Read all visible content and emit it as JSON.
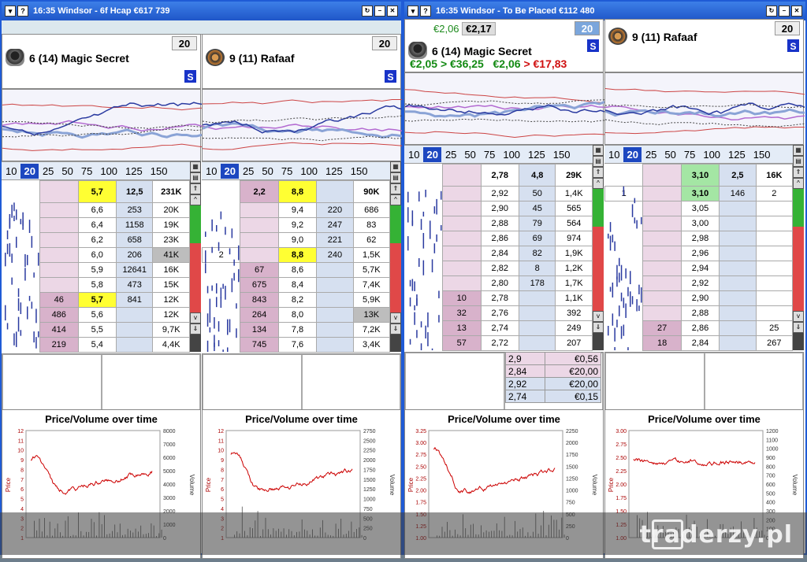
{
  "windows": [
    {
      "time": "16:35",
      "title_text": "16:35  Windsor - 6f Hcap   €617 739",
      "panels": [
        {
          "runner": "6  (14) Magic Secret",
          "stake": "20",
          "s": "S",
          "tabs": [
            "10",
            "20",
            "25",
            "50",
            "75",
            "100",
            "125",
            "150"
          ],
          "header": [
            "",
            "",
            "5,7",
            "12,5",
            "231K"
          ],
          "rows": [
            [
              "",
              "",
              "6,6",
              "253",
              "20K"
            ],
            [
              "",
              "",
              "6,4",
              "1158",
              "19K"
            ],
            [
              "",
              "",
              "6,2",
              "658",
              "23K"
            ],
            [
              "",
              "",
              "6,0",
              "206",
              "41K"
            ],
            [
              "",
              "",
              "5,9",
              "12641",
              "16K"
            ],
            [
              "",
              "",
              "5,8",
              "473",
              "15K"
            ],
            [
              "",
              "46",
              "5,7",
              "841",
              "12K"
            ],
            [
              "",
              "486",
              "5,6",
              "",
              "12K"
            ],
            [
              "",
              "414",
              "5,5",
              "",
              "9,7K"
            ],
            [
              "",
              "219",
              "5,4",
              "",
              "4,4K"
            ]
          ],
          "pv_title": "Price/Volume over time",
          "y_left": [
            "12",
            "11",
            "10",
            "9",
            "8",
            "7",
            "6",
            "5",
            "4",
            "3",
            "2",
            "1"
          ],
          "y_right": [
            "8000",
            "7000",
            "6000",
            "5000",
            "4000",
            "3000",
            "2000",
            "1000",
            "0"
          ],
          "ylabel_left": "Price",
          "ylabel_right": "Volume"
        },
        {
          "runner": "9  (11) Rafaaf",
          "stake": "20",
          "s": "S",
          "tabs": [
            "10",
            "20",
            "25",
            "50",
            "75",
            "100",
            "125",
            "150"
          ],
          "header": [
            "",
            "2,2",
            "8,8",
            "",
            "90K"
          ],
          "rows": [
            [
              "",
              "",
              "9,4",
              "220",
              "686"
            ],
            [
              "",
              "",
              "9,2",
              "247",
              "83"
            ],
            [
              "",
              "",
              "9,0",
              "221",
              "62"
            ],
            [
              "2",
              "",
              "8,8",
              "240",
              "1,5K"
            ],
            [
              "",
              "67",
              "8,6",
              "",
              "5,7K"
            ],
            [
              "",
              "675",
              "8,4",
              "",
              "7,4K"
            ],
            [
              "",
              "843",
              "8,2",
              "",
              "5,9K"
            ],
            [
              "",
              "264",
              "8,0",
              "",
              "13K"
            ],
            [
              "",
              "134",
              "7,8",
              "",
              "7,2K"
            ],
            [
              "",
              "745",
              "7,6",
              "",
              "3,4K"
            ]
          ],
          "pv_title": "Price/Volume over time",
          "y_left": [
            "12",
            "11",
            "10",
            "9",
            "8",
            "7",
            "6",
            "5",
            "4",
            "3",
            "2",
            "1"
          ],
          "y_right": [
            "2750",
            "2500",
            "2250",
            "2000",
            "1750",
            "1500",
            "1250",
            "1000",
            "750",
            "500",
            "250",
            "0"
          ],
          "ylabel_left": "Price",
          "ylabel_right": "Volume"
        }
      ]
    },
    {
      "title_text": "16:35  Windsor - To Be Placed   €112 480",
      "panels": [
        {
          "odds_small": "€2,06",
          "odds_box": "€2,17",
          "runner": "6  (14) Magic Secret",
          "stake": "20",
          "s": "S",
          "pl_line": {
            "a": "€2,05",
            "b": "> €36,25",
            "c": "€2,06",
            "d": "> €17,83"
          },
          "tabs": [
            "10",
            "20",
            "25",
            "50",
            "75",
            "100",
            "125",
            "150"
          ],
          "header": [
            "",
            "",
            "2,78",
            "4,8",
            "29K"
          ],
          "rows": [
            [
              "",
              "",
              "2,92",
              "50",
              "1,4K"
            ],
            [
              "",
              "",
              "2,90",
              "45",
              "565"
            ],
            [
              "",
              "",
              "2,88",
              "79",
              "564"
            ],
            [
              "",
              "",
              "2,86",
              "69",
              "974"
            ],
            [
              "",
              "",
              "2,84",
              "82",
              "1,9K"
            ],
            [
              "",
              "",
              "2,82",
              "8",
              "1,2K"
            ],
            [
              "",
              "",
              "2,80",
              "178",
              "1,7K"
            ],
            [
              "",
              "10",
              "2,78",
              "",
              "1,1K"
            ],
            [
              "",
              "32",
              "2,76",
              "",
              "392"
            ],
            [
              "",
              "13",
              "2,74",
              "",
              "249"
            ],
            [
              "",
              "57",
              "2,72",
              "",
              "207"
            ]
          ],
          "bets": [
            {
              "p": "2,9",
              "v": "€0,56",
              "type": "l"
            },
            {
              "p": "2,84",
              "v": "€20,00",
              "type": "l"
            },
            {
              "p": "2,92",
              "v": "€20,00",
              "type": "b"
            },
            {
              "p": "2,74",
              "v": "€0,15",
              "type": "b"
            }
          ],
          "pv_title": "Price/Volume over time",
          "y_left": [
            "3.25",
            "3.00",
            "2.75",
            "2.50",
            "2.25",
            "2.00",
            "1.75",
            "1.50",
            "1.25",
            "1.00"
          ],
          "y_right": [
            "2250",
            "2000",
            "1750",
            "1500",
            "1250",
            "1000",
            "750",
            "500",
            "250",
            "0"
          ],
          "ylabel_left": "Price",
          "ylabel_right": "Volume"
        },
        {
          "runner": "9  (11) Rafaaf",
          "stake": "20",
          "s": "S",
          "tabs": [
            "10",
            "20",
            "25",
            "50",
            "75",
            "100",
            "125",
            "150"
          ],
          "header": [
            "",
            "",
            "3,10",
            "2,5",
            "16K"
          ],
          "rows": [
            [
              "1",
              "",
              "3,10",
              "146",
              "2"
            ],
            [
              "",
              "",
              "3,05",
              "",
              ""
            ],
            [
              "",
              "",
              "3,00",
              "",
              ""
            ],
            [
              "",
              "",
              "2,98",
              "",
              ""
            ],
            [
              "",
              "",
              "2,96",
              "",
              ""
            ],
            [
              "",
              "",
              "2,94",
              "",
              ""
            ],
            [
              "",
              "",
              "2,92",
              "",
              ""
            ],
            [
              "",
              "",
              "2,90",
              "",
              ""
            ],
            [
              "",
              "",
              "2,88",
              "",
              ""
            ],
            [
              "",
              "27",
              "2,86",
              "",
              "25"
            ],
            [
              "",
              "18",
              "2,84",
              "",
              "267"
            ]
          ],
          "pv_title": "Price/Volume over time",
          "y_left": [
            "3.00",
            "2.75",
            "2.50",
            "2.25",
            "2.00",
            "1.75",
            "1.50",
            "1.25",
            "1.00"
          ],
          "y_right": [
            "1200",
            "1100",
            "1000",
            "900",
            "800",
            "700",
            "600",
            "500",
            "400",
            "300",
            "200",
            "100",
            "0"
          ],
          "ylabel_left": "Price",
          "ylabel_right": "Volume"
        }
      ]
    }
  ],
  "watermark": "traderzy.pl",
  "colors": {
    "title": "#1f56c8",
    "back": "#ecd7e6",
    "lay": "#d6e0f0",
    "highlight": "#ffff33",
    "green": "#a4e6a4"
  }
}
